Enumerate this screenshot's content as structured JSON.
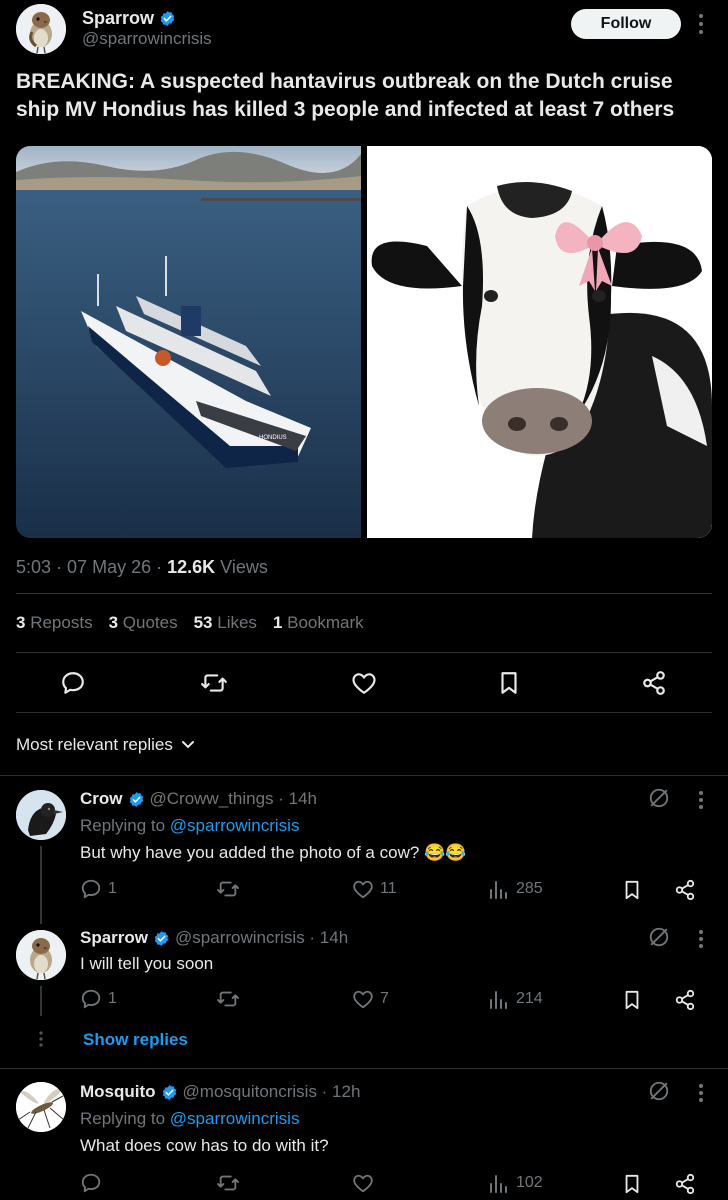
{
  "post": {
    "author_name": "Sparrow",
    "author_handle": "@sparrowincrisis",
    "follow_label": "Follow",
    "text": "BREAKING: A suspected hantavirus outbreak on the Dutch cruise ship MV Hondius has killed 3 people and infected at least 7 others",
    "ship_label": "HONDIUS",
    "meta": {
      "time": "5:03",
      "sep": "·",
      "date": "07 May 26",
      "views_count": "12.6K",
      "views_label": "Views"
    },
    "stats": {
      "reposts_count": "3",
      "reposts_label": "Reposts",
      "quotes_count": "3",
      "quotes_label": "Quotes",
      "likes_count": "53",
      "likes_label": "Likes",
      "bookmarks_count": "1",
      "bookmarks_label": "Bookmark"
    }
  },
  "replies_header": {
    "label": "Most relevant replies"
  },
  "replies": [
    {
      "name": "Crow",
      "handle_time": "@Croww_things · 14h",
      "replying_prefix": "Replying to",
      "replying_to": "@sparrowincrisis",
      "text": "But why have you added the photo of a cow? 😂😂",
      "comments": "1",
      "likes": "11",
      "views": "285"
    },
    {
      "name": "Sparrow",
      "handle_time": "@sparrowincrisis · 14h",
      "text": "I will tell you soon",
      "comments": "1",
      "likes": "7",
      "views": "214",
      "show_replies": "Show replies"
    },
    {
      "name": "Mosquito",
      "handle_time": "@mosquitoncrisis · 12h",
      "replying_prefix": "Replying to",
      "replying_to": "@sparrowincrisis",
      "text": "What does cow has to do with it?",
      "views": "102"
    }
  ],
  "colors": {
    "background": "#000000",
    "text": "#e7e9ea",
    "secondary": "#71767b",
    "link": "#1d9bf0",
    "verified": "#1d9bf0",
    "divider": "#2f3336"
  }
}
